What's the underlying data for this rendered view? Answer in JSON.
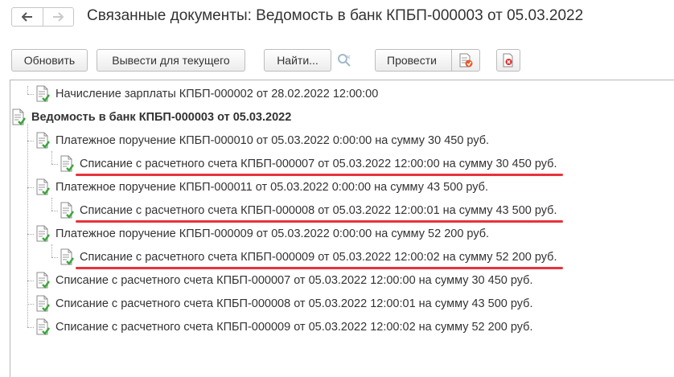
{
  "window": {
    "title": "Связанные документы: Ведомость в банк КПБП-000003 от 05.03.2022"
  },
  "nav": {
    "back_icon": "arrow-left-icon",
    "forward_icon": "arrow-right-icon"
  },
  "toolbar": {
    "refresh_label": "Обновить",
    "output_current_label": "Вывести для текущего",
    "find_label": "Найти...",
    "cancel_search_icon": "cancel-search-icon",
    "post_label": "Провести",
    "post_icon": "post-document-icon",
    "delete_icon": "delete-document-icon"
  },
  "tree": {
    "rows": [
      {
        "text": "Начисление зарплаты КПБП-000002 от 28.02.2022 12:00:00",
        "level": 1,
        "bold": false,
        "highlighted": false
      },
      {
        "text": "Ведомость в банк КПБП-000003 от 05.03.2022",
        "level": 0,
        "bold": true,
        "highlighted": false
      },
      {
        "text": "Платежное поручение КПБП-000010 от 05.03.2022 0:00:00 на сумму 30 450 руб.",
        "level": 1,
        "bold": false,
        "highlighted": false
      },
      {
        "text": "Списание с расчетного счета КПБП-000007 от 05.03.2022 12:00:00 на сумму 30 450 руб.",
        "level": 2,
        "bold": false,
        "highlighted": true
      },
      {
        "text": "Платежное поручение КПБП-000011 от 05.03.2022 0:00:00 на сумму 43 500 руб.",
        "level": 1,
        "bold": false,
        "highlighted": false
      },
      {
        "text": "Списание с расчетного счета КПБП-000008 от 05.03.2022 12:00:01 на сумму 43 500 руб.",
        "level": 2,
        "bold": false,
        "highlighted": true
      },
      {
        "text": "Платежное поручение КПБП-000009 от 05.03.2022 0:00:00 на сумму 52 200 руб.",
        "level": 1,
        "bold": false,
        "highlighted": false
      },
      {
        "text": "Списание с расчетного счета КПБП-000009 от 05.03.2022 12:00:02 на сумму 52 200 руб.",
        "level": 2,
        "bold": false,
        "highlighted": true
      },
      {
        "text": "Списание с расчетного счета КПБП-000007 от 05.03.2022 12:00:00 на сумму 30 450 руб.",
        "level": 1,
        "bold": false,
        "highlighted": false
      },
      {
        "text": "Списание с расчетного счета КПБП-000008 от 05.03.2022 12:00:01 на сумму 43 500 руб.",
        "level": 1,
        "bold": false,
        "highlighted": false
      },
      {
        "text": "Списание с расчетного счета КПБП-000009 от 05.03.2022 12:00:02 на сумму 52 200 руб.",
        "level": 1,
        "bold": false,
        "highlighted": false
      }
    ],
    "row_icon": "posted-document-icon"
  },
  "colors": {
    "highlight_underline": "#e8323a",
    "check_green": "#3aa63a"
  }
}
